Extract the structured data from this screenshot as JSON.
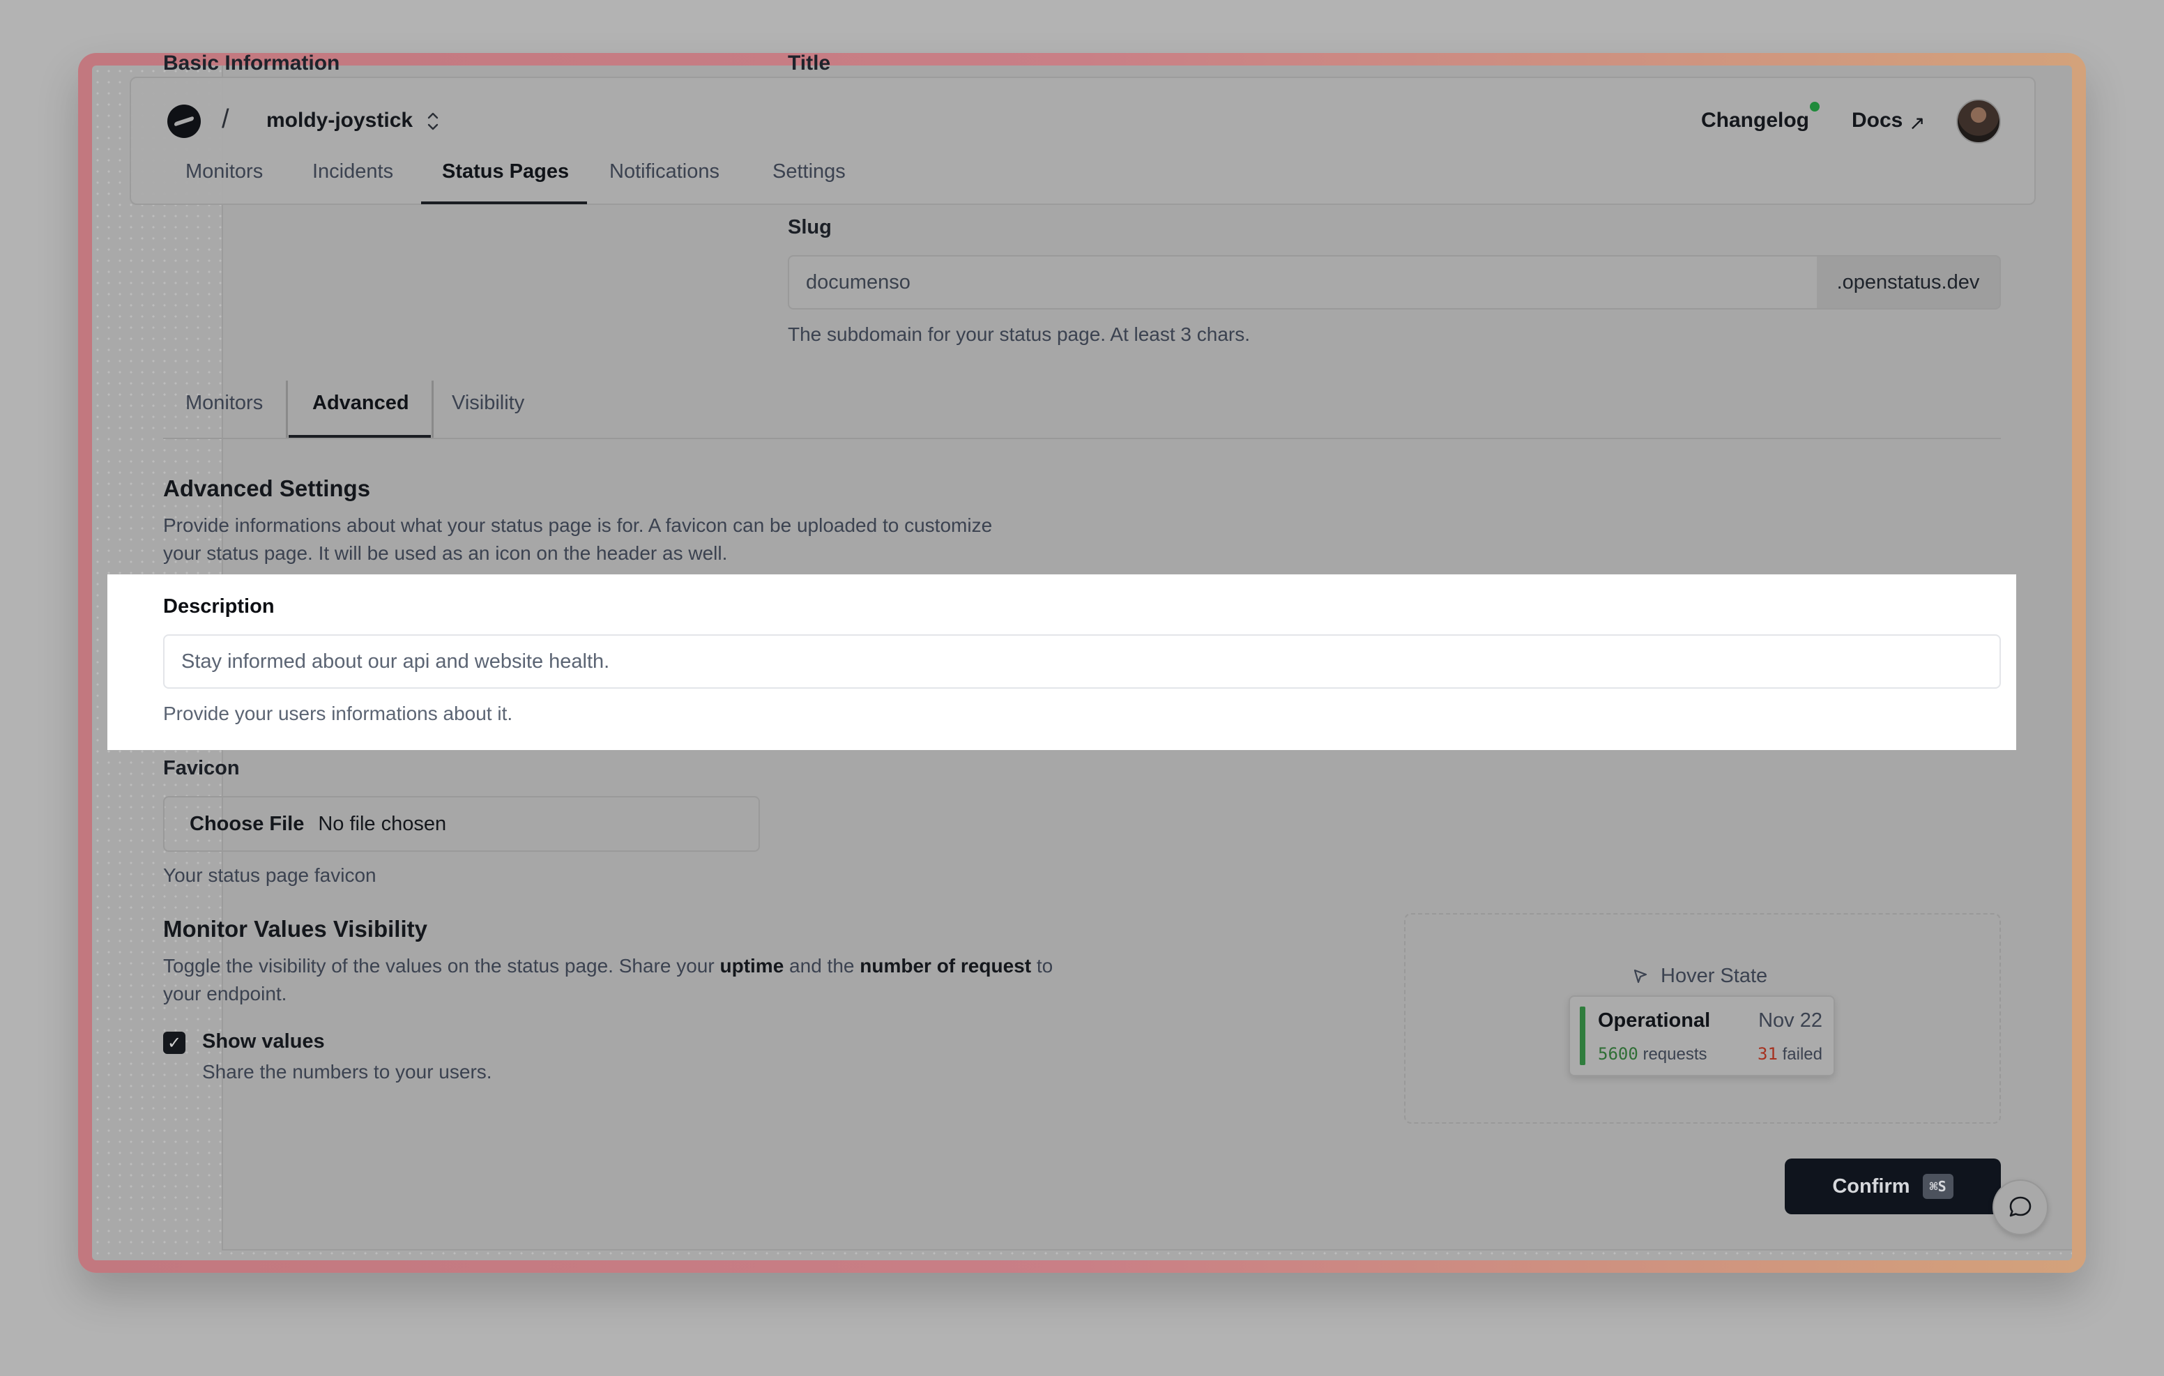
{
  "background_sections": {
    "left_heading": "Basic Information",
    "right_heading": "Title"
  },
  "header": {
    "project_name": "moldy-joystick",
    "nav": [
      "Monitors",
      "Incidents",
      "Status Pages",
      "Notifications",
      "Settings"
    ],
    "active_nav": "Status Pages",
    "changelog": "Changelog",
    "docs": "Docs",
    "docs_arrow": "↗"
  },
  "slug": {
    "label": "Slug",
    "value": "documenso",
    "suffix": ".openstatus.dev",
    "help": "The subdomain for your status page. At least 3 chars."
  },
  "subtabs": {
    "items": [
      "Monitors",
      "Advanced",
      "Visibility"
    ],
    "active": "Advanced"
  },
  "advanced": {
    "title": "Advanced Settings",
    "line1": "Provide informations about what your status page is for. A favicon can be uploaded to customize",
    "line2": "your status page. It will be used as an icon on the header as well."
  },
  "description": {
    "label": "Description",
    "value": "Stay informed about our api and website health.",
    "help": "Provide your users informations about it."
  },
  "favicon": {
    "label": "Favicon",
    "button": "Choose File",
    "status": "No file chosen",
    "help": "Your status page favicon"
  },
  "visibility": {
    "title": "Monitor Values Visibility",
    "line1_a": "Toggle the visibility of the values on the status page. Share your ",
    "line1_b": "uptime",
    "line1_c": " and the ",
    "line1_d": "number of request",
    "line1_e": " to",
    "line2": "your endpoint.",
    "checkbox_label": "Show values",
    "checkbox_help": "Share the numbers to your users",
    "checkbox_help_end": ".",
    "checked": true
  },
  "preview": {
    "label": "Hover State",
    "status": "Operational",
    "date": "Nov 22",
    "requests_count": "5600",
    "requests_label": "requests",
    "failed_count": "31",
    "failed_label": "failed"
  },
  "confirm": {
    "label": "Confirm",
    "shortcut": "⌘S"
  },
  "colors": {
    "accent": "#0f141d",
    "success": "#2f7d3d",
    "danger": "#a6311f",
    "highlight": "#ffffff"
  }
}
